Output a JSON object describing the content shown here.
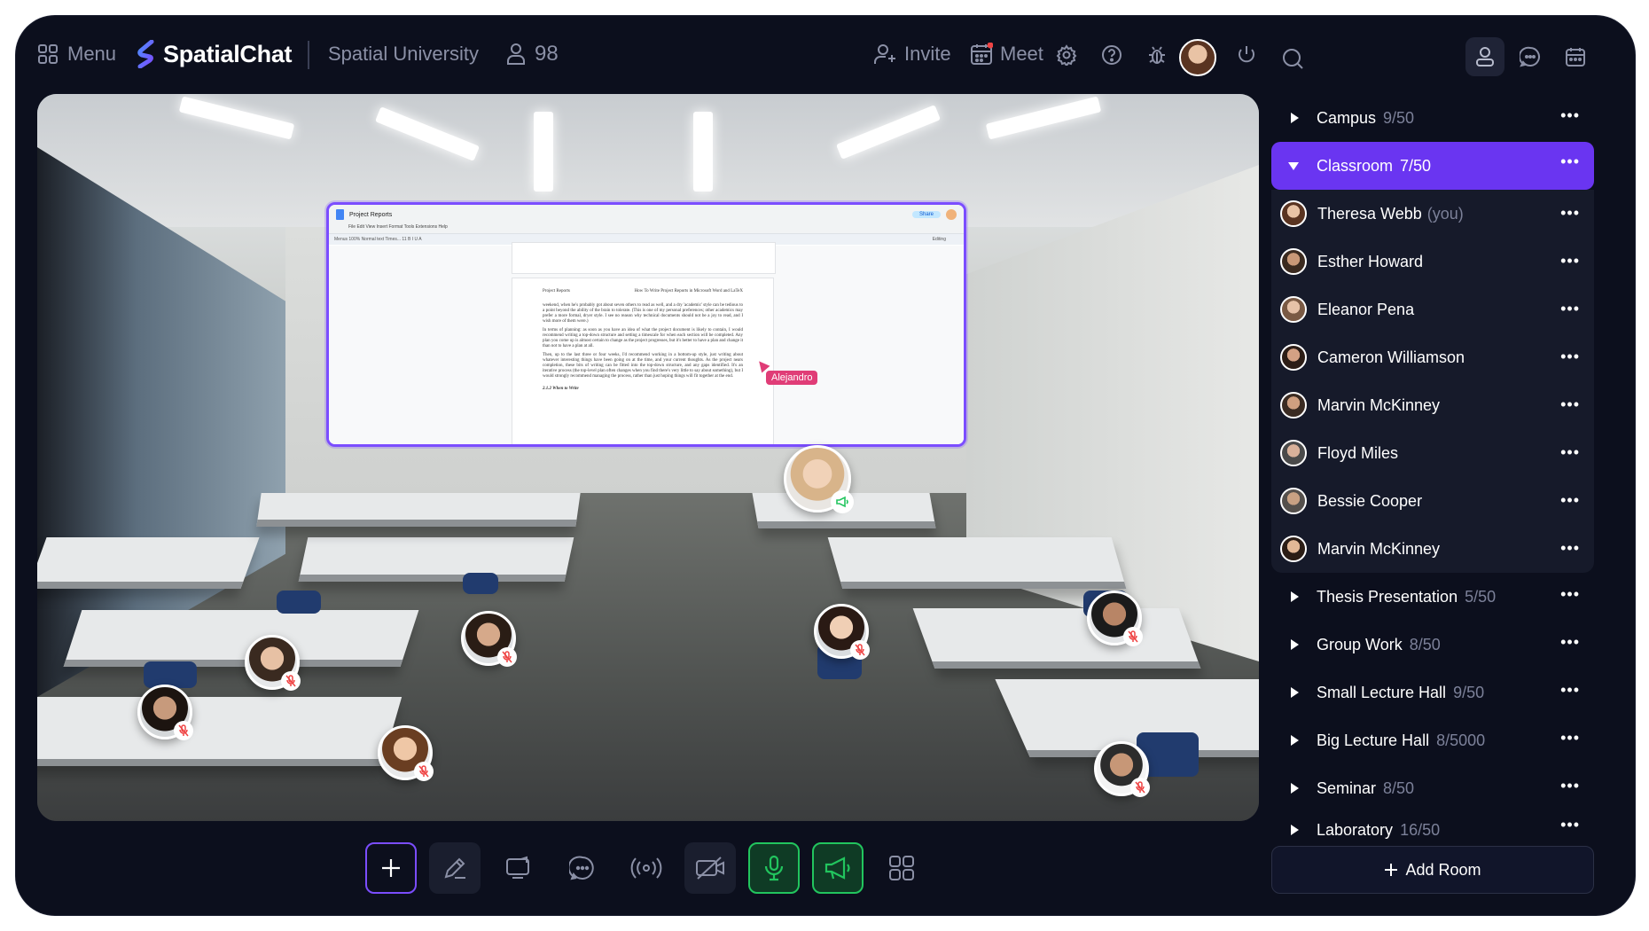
{
  "topbar": {
    "menu_label": "Menu",
    "brand": "SpatialChat",
    "organization": "Spatial University",
    "participant_count": "98",
    "invite_label": "Invite",
    "meet_label": "Meet"
  },
  "shared_doc": {
    "title": "Project Reports",
    "menu": "File   Edit   View   Insert   Format   Tools   Extensions   Help",
    "toolbar": "Menus   100%   Normal text   Times...   11   B  I  U  A",
    "share_label": "Share",
    "editing_label": "Editing",
    "page_header_left": "Project Reports",
    "page_header_right": "How To Write Project Reports in Microsoft Word and LaTeX",
    "para1": "weekend, when he's probably got about seven others to read as well, and a dry 'academic' style can be tedious to a point beyond the ability of the brain to tolerate. (This is one of my personal preferences; other academics may prefer a more formal, dryer style. I see no reason why technical documents should not be a joy to read, and I wish more of them were.)",
    "para2": "In terms of planning: as soon as you have an idea of what the project document is likely to contain, I would recommend writing a top-down structure and setting a timescale for when each section will be completed. Any plan you come up is almost certain to change as the project progresses, but it's better to have a plan and change it than not to have a plan at all.",
    "para3": "Then, up to the last three or four weeks, I'd recommend working in a bottom-up style, just writing about whatever interesting things have been going on at the time, and your current thoughts. As the project nears completion, these bits of writing can be fitted into the top-down structure, and any gaps identified. It's an iterative process (the top-level plan often changes when you find there's very little to say about something), but I would strongly recommend managing the process, rather than just hoping things will fit together at the end.",
    "heading": "2.1.2   When to Write",
    "cursor_name": "Alejandro"
  },
  "rooms_top": [
    {
      "name": "Campus",
      "capacity": "9/50"
    },
    {
      "name": "Classroom",
      "capacity": "7/50"
    }
  ],
  "members": [
    {
      "name": "Theresa Webb",
      "suffix": "(you)"
    },
    {
      "name": "Esther Howard",
      "suffix": ""
    },
    {
      "name": "Eleanor Pena",
      "suffix": ""
    },
    {
      "name": "Cameron Williamson",
      "suffix": ""
    },
    {
      "name": "Marvin McKinney",
      "suffix": ""
    },
    {
      "name": "Floyd Miles",
      "suffix": ""
    },
    {
      "name": "Bessie Cooper",
      "suffix": ""
    },
    {
      "name": "Marvin McKinney",
      "suffix": ""
    }
  ],
  "rooms_bottom": [
    {
      "name": "Thesis Presentation",
      "capacity": "5/50"
    },
    {
      "name": "Group Work",
      "capacity": "8/50"
    },
    {
      "name": "Small Lecture Hall",
      "capacity": "9/50"
    },
    {
      "name": "Big Lecture Hall",
      "capacity": "8/5000"
    },
    {
      "name": "Seminar",
      "capacity": "8/50"
    },
    {
      "name": "Laboratory",
      "capacity": "16/50"
    }
  ],
  "add_room_label": "Add Room",
  "more_label": "•••",
  "colors": {
    "background": "#0c0f1d",
    "accent": "#6a35f1",
    "mic_on": "#22c55e",
    "cursor_tag": "#e03d77"
  },
  "icons": [
    "grid-icon",
    "spatialchat-logo-icon",
    "user-icon",
    "add-user-icon",
    "calendar-icon",
    "settings-icon",
    "help-icon",
    "bug-icon",
    "power-icon",
    "search-icon",
    "profile-icon",
    "chat-icon",
    "plus-icon",
    "pen-icon",
    "screen-share-icon",
    "broadcast-icon",
    "camera-off-icon",
    "microphone-icon",
    "megaphone-icon",
    "apps-grid-icon"
  ]
}
